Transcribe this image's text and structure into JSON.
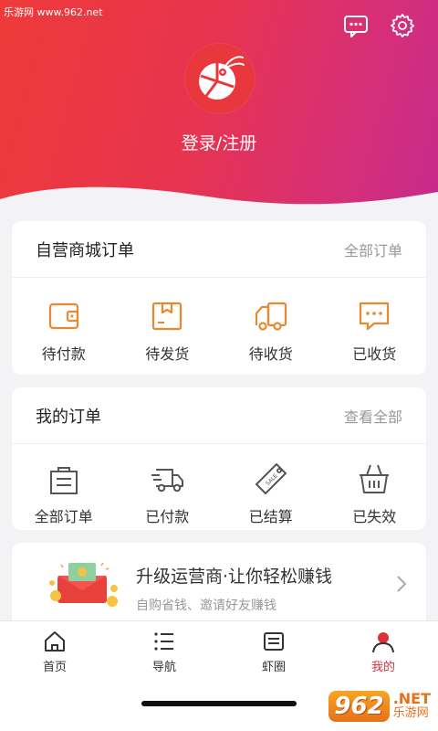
{
  "watermark": {
    "top_text": "乐游网 www.962.net",
    "logo": "962",
    "net": ".NET",
    "cn": "乐游网"
  },
  "header": {
    "login_label": "登录/注册",
    "icons": [
      "message-icon",
      "gear-icon"
    ]
  },
  "mall_orders": {
    "title": "自营商城订单",
    "more": "全部订单",
    "items": [
      {
        "label": "待付款",
        "icon": "wallet-icon"
      },
      {
        "label": "待发货",
        "icon": "box-icon"
      },
      {
        "label": "待收货",
        "icon": "truck-icon"
      },
      {
        "label": "已收货",
        "icon": "chat-icon"
      }
    ]
  },
  "my_orders": {
    "title": "我的订单",
    "more": "查看全部",
    "items": [
      {
        "label": "全部订单",
        "icon": "bag-icon"
      },
      {
        "label": "已付款",
        "icon": "delivery-icon"
      },
      {
        "label": "已结算",
        "icon": "tag-icon"
      },
      {
        "label": "已失效",
        "icon": "basket-icon"
      }
    ]
  },
  "promo": {
    "title": "升级运营商·让你轻松赚钱",
    "subtitle": "自购省钱、邀请好友赚钱"
  },
  "tabbar": {
    "items": [
      {
        "label": "首页",
        "icon": "home-icon"
      },
      {
        "label": "导航",
        "icon": "list-icon"
      },
      {
        "label": "虾圈",
        "icon": "feed-icon"
      },
      {
        "label": "我的",
        "icon": "user-icon",
        "active": true
      }
    ]
  },
  "colors": {
    "accent": "#e02e3b",
    "orange_icon": "#e8892f",
    "gray_icon": "#555555"
  }
}
